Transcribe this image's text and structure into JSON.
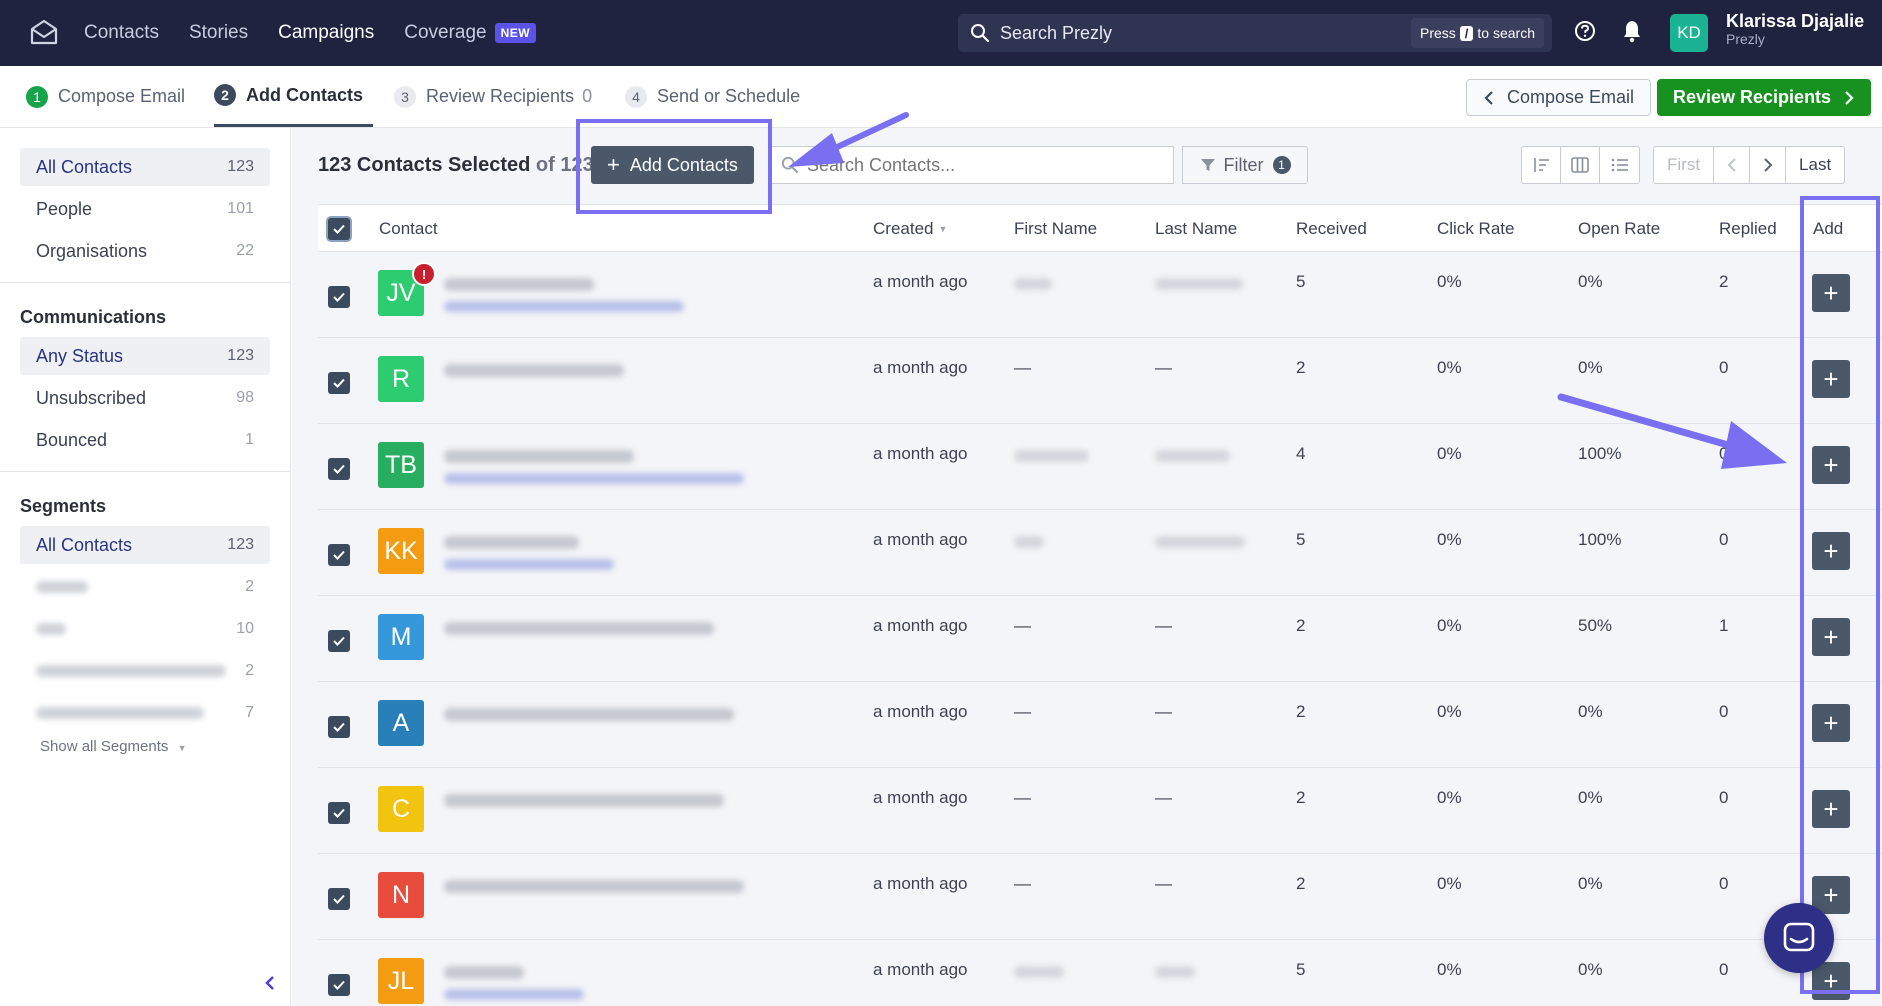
{
  "nav": {
    "links": [
      "Contacts",
      "Stories",
      "Campaigns",
      "Coverage"
    ],
    "active": "Campaigns",
    "new_badge": "NEW",
    "search_placeholder": "Search Prezly",
    "search_hint_prefix": "Press",
    "search_hint_key": "/",
    "search_hint_suffix": "to search",
    "user_initials": "KD",
    "user_name": "Klarissa Djajalie",
    "user_org": "Prezly",
    "avatar_color": "#1ab394"
  },
  "steps": [
    {
      "num": "1",
      "label": "Compose Email",
      "state": "done"
    },
    {
      "num": "2",
      "label": "Add Contacts",
      "state": "active"
    },
    {
      "num": "3",
      "label": "Review Recipients",
      "count": "0",
      "state": "todo"
    },
    {
      "num": "4",
      "label": "Send or Schedule",
      "state": "todo"
    }
  ],
  "step_actions": {
    "back_label": "Compose Email",
    "next_label": "Review Recipients"
  },
  "sidebar": {
    "contacts": [
      {
        "label": "All Contacts",
        "count": "123",
        "active": true
      },
      {
        "label": "People",
        "count": "101"
      },
      {
        "label": "Organisations",
        "count": "22"
      }
    ],
    "communications_heading": "Communications",
    "communications": [
      {
        "label": "Any Status",
        "count": "123",
        "active": true
      },
      {
        "label": "Unsubscribed",
        "count": "98"
      },
      {
        "label": "Bounced",
        "count": "1"
      }
    ],
    "segments_heading": "Segments",
    "segments_all": {
      "label": "All Contacts",
      "count": "123"
    },
    "segments_blurred_counts": [
      "2",
      "10",
      "2",
      "7"
    ],
    "show_all": "Show all Segments"
  },
  "toolbar": {
    "selected_count": "123 Contacts Selected",
    "of_total": "of 123",
    "add_contacts": "Add Contacts",
    "search_placeholder": "Search Contacts...",
    "filter_label": "Filter",
    "filter_count": "1",
    "pager": [
      "First",
      "Last"
    ]
  },
  "table": {
    "columns": [
      "Contact",
      "Created",
      "First Name",
      "Last Name",
      "Received",
      "Click Rate",
      "Open Rate",
      "Replied",
      "Add"
    ],
    "rows": [
      {
        "initials": "JV",
        "color": "#2ecc71",
        "alert": true,
        "created": "a month ago",
        "first": "",
        "last": "",
        "received": "5",
        "click": "0%",
        "open": "0%",
        "replied": "2"
      },
      {
        "initials": "R",
        "color": "#2ecc71",
        "created": "a month ago",
        "first": "—",
        "last": "—",
        "received": "2",
        "click": "0%",
        "open": "0%",
        "replied": "0"
      },
      {
        "initials": "TB",
        "color": "#27ae60",
        "created": "a month ago",
        "first": "",
        "last": "",
        "received": "4",
        "click": "0%",
        "open": "100%",
        "replied": "0"
      },
      {
        "initials": "KK",
        "color": "#f39c12",
        "created": "a month ago",
        "first": "",
        "last": "",
        "received": "5",
        "click": "0%",
        "open": "100%",
        "replied": "0"
      },
      {
        "initials": "M",
        "color": "#3498db",
        "created": "a month ago",
        "first": "—",
        "last": "—",
        "received": "2",
        "click": "0%",
        "open": "50%",
        "replied": "1"
      },
      {
        "initials": "A",
        "color": "#2980b9",
        "created": "a month ago",
        "first": "—",
        "last": "—",
        "received": "2",
        "click": "0%",
        "open": "0%",
        "replied": "0"
      },
      {
        "initials": "C",
        "color": "#f1c40f",
        "created": "a month ago",
        "first": "—",
        "last": "—",
        "received": "2",
        "click": "0%",
        "open": "0%",
        "replied": "0"
      },
      {
        "initials": "N",
        "color": "#e74c3c",
        "created": "a month ago",
        "first": "—",
        "last": "—",
        "received": "2",
        "click": "0%",
        "open": "0%",
        "replied": "0"
      },
      {
        "initials": "JL",
        "color": "#f39c12",
        "created": "a month ago",
        "first": "",
        "last": "",
        "received": "5",
        "click": "0%",
        "open": "0%",
        "replied": "0"
      }
    ]
  },
  "colors": {
    "nav_bg": "#1f2340",
    "primary_green": "#17911f",
    "annotation": "#7a6ff0",
    "button_slate": "#4a5869"
  }
}
